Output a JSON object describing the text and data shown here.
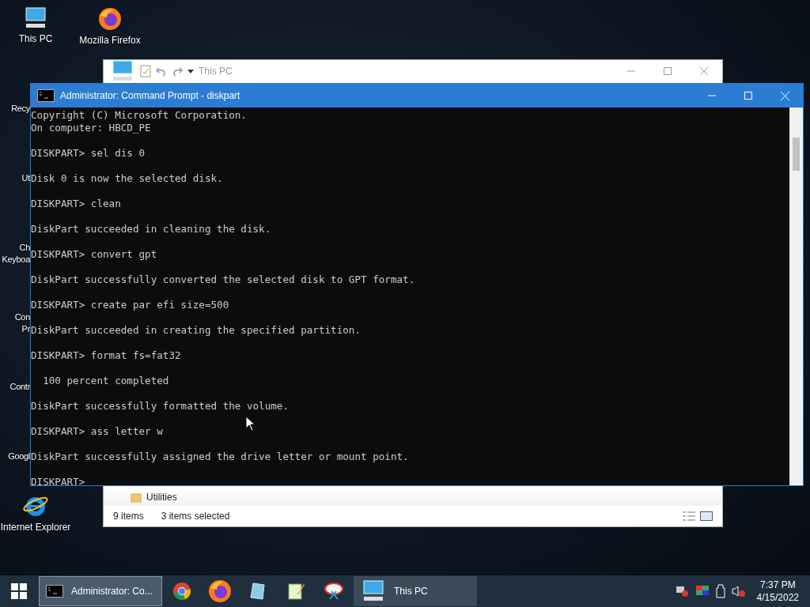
{
  "desktop_icons": [
    {
      "kind": "monitor",
      "lines": [
        "This PC"
      ]
    },
    {
      "kind": "clipped",
      "lines": [
        "Recy"
      ]
    },
    {
      "kind": "clipped",
      "lines": [
        "Ut"
      ]
    },
    {
      "kind": "clipped",
      "lines": [
        "Ch",
        "Keyboa"
      ]
    },
    {
      "kind": "clipped",
      "lines": [
        "Con",
        "Pr"
      ]
    },
    {
      "kind": "clipped",
      "lines": [
        "Contr"
      ]
    },
    {
      "kind": "clipped",
      "lines": [
        "Googl"
      ]
    },
    {
      "kind": "ie",
      "lines": [
        "Internet Explorer"
      ]
    }
  ],
  "desktop_icons_col2": [
    {
      "kind": "firefox",
      "lines": [
        "Mozilla Firefox"
      ]
    }
  ],
  "explorer": {
    "title": "This PC",
    "folder_row": "Utilities",
    "status": {
      "items": "9 items",
      "selected": "3 items selected"
    }
  },
  "cmd": {
    "title": "Administrator: Command Prompt - diskpart",
    "blocks": [
      [
        "Copyright (C) Microsoft Corporation.",
        "On computer: HBCD_PE"
      ],
      [
        "DISKPART> sel dis 0"
      ],
      [
        "Disk 0 is now the selected disk."
      ],
      [
        "DISKPART> clean"
      ],
      [
        "DiskPart succeeded in cleaning the disk."
      ],
      [
        "DISKPART> convert gpt"
      ],
      [
        "DiskPart successfully converted the selected disk to GPT format."
      ],
      [
        "DISKPART> create par efi size=500"
      ],
      [
        "DiskPart succeeded in creating the specified partition."
      ],
      [
        "DISKPART> format fs=fat32"
      ],
      [
        "  100 percent completed"
      ],
      [
        "DiskPart successfully formatted the volume."
      ],
      [
        "DISKPART> ass letter w"
      ],
      [
        "DiskPart successfully assigned the drive letter or mount point."
      ],
      [
        "DISKPART> "
      ]
    ]
  },
  "taskbar": {
    "items": [
      {
        "kind": "window",
        "label": "Administrator: Co...",
        "selected": true
      },
      {
        "kind": "pinned"
      },
      {
        "kind": "pinned"
      },
      {
        "kind": "pinned"
      },
      {
        "kind": "pinned"
      },
      {
        "kind": "pinned"
      },
      {
        "kind": "window",
        "label": "This PC",
        "selected": false
      }
    ],
    "time": "7:37 PM",
    "date": "4/15/2022"
  }
}
